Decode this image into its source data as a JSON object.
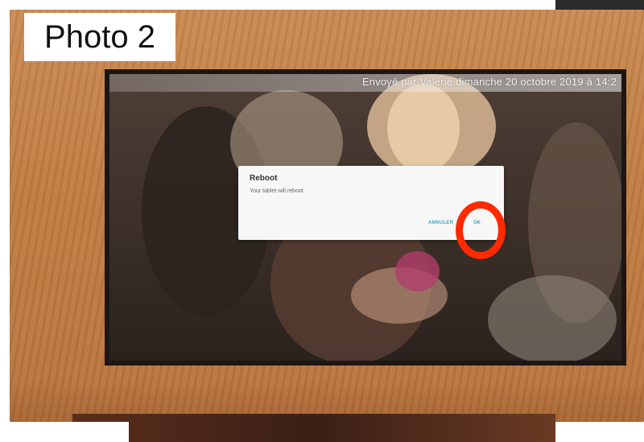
{
  "label": {
    "text": "Photo 2"
  },
  "screen": {
    "banner_text": "Envoyé par Valerie dimanche 20 octobre 2019 à 14:2"
  },
  "dialog": {
    "title": "Reboot",
    "message": "Your tablet will reboot.",
    "cancel_label": "ANNULER",
    "ok_label": "OK"
  },
  "colors": {
    "annotation": "#ff2a00",
    "dialog_button": "#3aa8bd",
    "frame_wood": "#c07d45"
  }
}
